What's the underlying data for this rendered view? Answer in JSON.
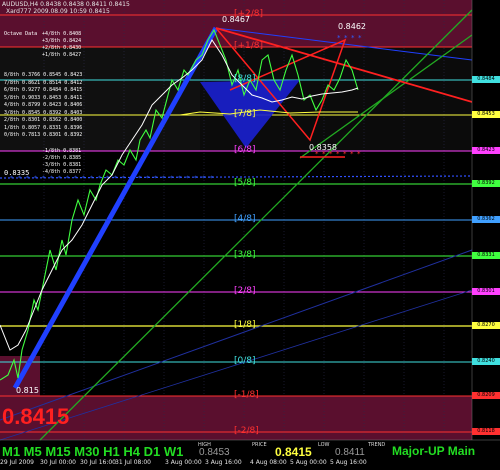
{
  "header": {
    "title": "AUDUSD,H4  0.8438 0.8438 0.8411 0.8415",
    "indicator": "Xard777 2009.08.09 10:59 0.8415"
  },
  "octave": {
    "title": "Octave Data",
    "rows": [
      "+4/8th 0.8408",
      "+3/8th 0.8424",
      "+2/8th 0.8430",
      "+1/8th 0.8427"
    ],
    "left_rows": [
      "8/8th 0.3766  0.8545  0.8423",
      "7/8th 0.8621  0.8514  0.8412",
      "6/8th 0.9277  0.8484  0.8415",
      "5/8th 0.9033  0.8453  0.8411",
      "4/8th 0.8799  0.8423  0.8406",
      "3/8th 0.8545  0.8392  0.8403",
      "2/8th 0.8301  0.8362  0.8400",
      "1/8th 0.8057  0.8331  0.8396",
      "0/8th 0.7813  0.8301  0.8392"
    ],
    "minus_rows": [
      "-1/8th 0.8381",
      "-2/8th 0.8385",
      "-3/8th 0.8381",
      "-4/8th 0.8377"
    ],
    "left_value": "0.8335"
  },
  "levels": [
    {
      "label": "[+2/8]",
      "color": "#ff3030"
    },
    {
      "label": "[+1/8]",
      "color": "#ff3030"
    },
    {
      "label": "[8/8]",
      "color": "#40e0e0"
    },
    {
      "label": "[7/8]",
      "color": "#ffff40"
    },
    {
      "label": "[6/8]",
      "color": "#ff40ff"
    },
    {
      "label": "[5/8]",
      "color": "#40ff40"
    },
    {
      "label": "[4/8]",
      "color": "#40a0ff"
    },
    {
      "label": "[3/8]",
      "color": "#40ff40"
    },
    {
      "label": "[2/8]",
      "color": "#ff40ff"
    },
    {
      "label": "[1/8]",
      "color": "#ffff40"
    },
    {
      "label": "[0/8]",
      "color": "#40e0e0"
    },
    {
      "label": "[-1/8]",
      "color": "#ff3030"
    },
    {
      "label": "[-2/8]",
      "color": "#ff3030"
    }
  ],
  "price_tags": [
    "0.8484",
    "0.8453",
    "0.8423",
    "0.8392",
    "0.8362",
    "0.8331",
    "0.8301",
    "0.8270",
    "0.8240",
    "0.8209",
    "0.8179",
    "0.8148",
    "0.8118"
  ],
  "points": {
    "high": "0.8467",
    "right_high": "0.8462",
    "low": "0.8358",
    "left_low": "0.815"
  },
  "xaxis": [
    "29 Jul 2009",
    "30 Jul 00:00",
    "30 Jul 16:00",
    "31 Jul 08:00",
    "3 Aug 00:00",
    "3 Aug 16:00",
    "4 Aug 08:00",
    "5 Aug 00:00",
    "5 Aug 16:00"
  ],
  "footer": {
    "price_big": "0.8415",
    "timeframes": "M1 M5 M15 M30 H1 H4 D1 W1",
    "high_label": "HIGH",
    "high_value": "0.8453",
    "price_label": "PRICE",
    "price_value": "0.8415",
    "low_label": "LOW",
    "low_value": "0.8411",
    "trend_label": "TREND",
    "trend_value": "Major-UP Main"
  }
}
